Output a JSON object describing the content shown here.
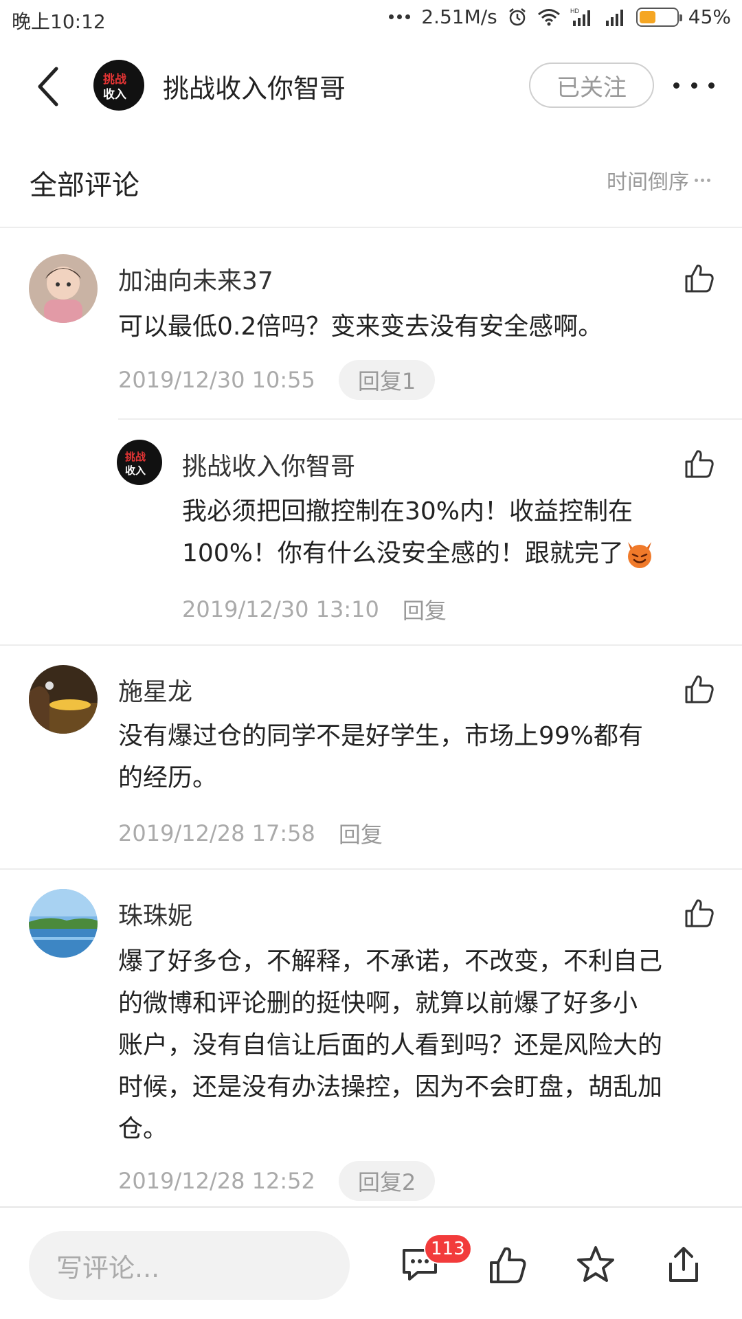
{
  "status_bar": {
    "time": "晚上10:12",
    "net_speed": "2.51M/s",
    "battery": "45%",
    "battery_level": 0.45,
    "icons": [
      "alarm-icon",
      "wifi-icon",
      "hd-signal-icon",
      "signal-icon",
      "battery-icon"
    ]
  },
  "header": {
    "logo_text_top": "挑战",
    "logo_text_bottom": "收入",
    "title": "挑战收入你智哥",
    "follow_label": "已关注"
  },
  "section": {
    "title": "全部评论",
    "sort_label": "时间倒序"
  },
  "comments": [
    {
      "user": "加油向未来37",
      "text": "可以最低0.2倍吗？变来变去没有安全感啊。",
      "time": "2019/12/30 10:55",
      "reply_label": "回复1",
      "replies": [
        {
          "user": "挑战收入你智哥",
          "text_line1": "我必须把回撤控制在30%内！收益控制在",
          "text_line2": "100%！你有什么没安全感的！跟就完了",
          "emoji": "devil-emoji",
          "time": "2019/12/30 13:10",
          "reply_label": "回复"
        }
      ]
    },
    {
      "user": "施星龙",
      "text_line1": "没有爆过仓的同学不是好学生，市场上99%都有",
      "text_line2": "的经历。",
      "time": "2019/12/28 17:58",
      "reply_label": "回复"
    },
    {
      "user": "珠珠妮",
      "text_line1": "爆了好多仓，不解释，不承诺，不改变，不利自己",
      "text_line2": "的微博和评论删的挺快啊，就算以前爆了好多小",
      "text_line3": "账户，没有自信让后面的人看到吗？还是风险大的",
      "text_line4": "时候，还是没有办法操控，因为不会盯盘，胡乱加",
      "text_line5": "仓。",
      "time": "2019/12/28 12:52",
      "reply_label": "回复2"
    }
  ],
  "bottom_bar": {
    "input_placeholder": "写评论...",
    "comment_count": "113",
    "icons": [
      "comment-icon",
      "like-icon",
      "star-icon",
      "share-icon"
    ]
  },
  "colors": {
    "badge_red": "#f23b3b",
    "battery_orange": "#f5a623",
    "meta_gray": "#aaaaaa"
  }
}
